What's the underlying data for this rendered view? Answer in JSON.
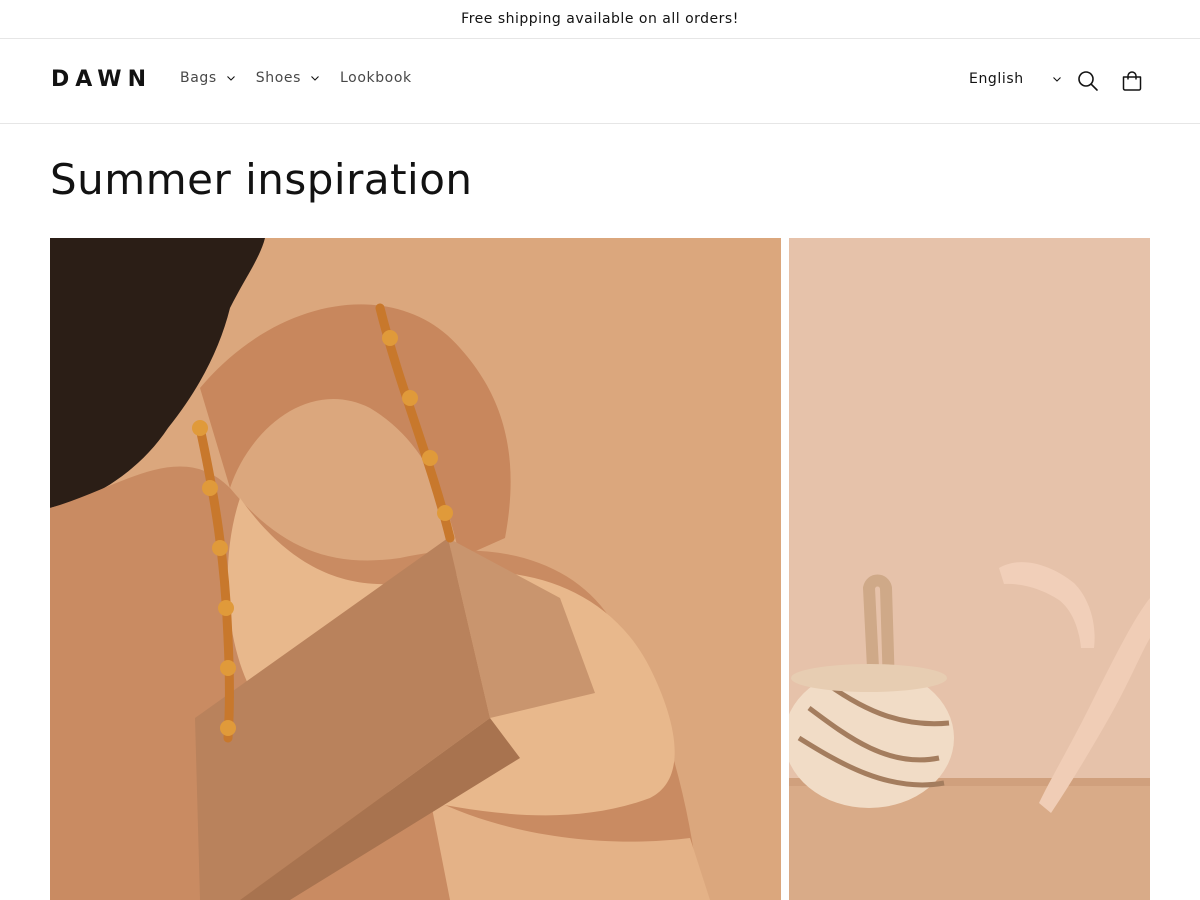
{
  "announcement": {
    "text": "Free shipping available on all orders!"
  },
  "header": {
    "logo": "DAWN",
    "nav": [
      {
        "label": "Bags",
        "has_dropdown": true
      },
      {
        "label": "Shoes",
        "has_dropdown": true
      },
      {
        "label": "Lookbook",
        "has_dropdown": false
      }
    ],
    "locale": {
      "selected": "English"
    },
    "icons": {
      "search": "search-icon",
      "cart": "cart-icon",
      "dropdown": "chevron-down-icon"
    }
  },
  "page": {
    "title": "Summer inspiration"
  },
  "gallery": {
    "images": [
      {
        "name": "model-with-chain-strap-bag",
        "background": "#d9a47a"
      },
      {
        "name": "hand-holding-spiral-bucket-bag",
        "background": "#e6c2aa"
      }
    ]
  },
  "colors": {
    "text": "#121212",
    "border": "#e6e6e6",
    "background": "#ffffff"
  }
}
